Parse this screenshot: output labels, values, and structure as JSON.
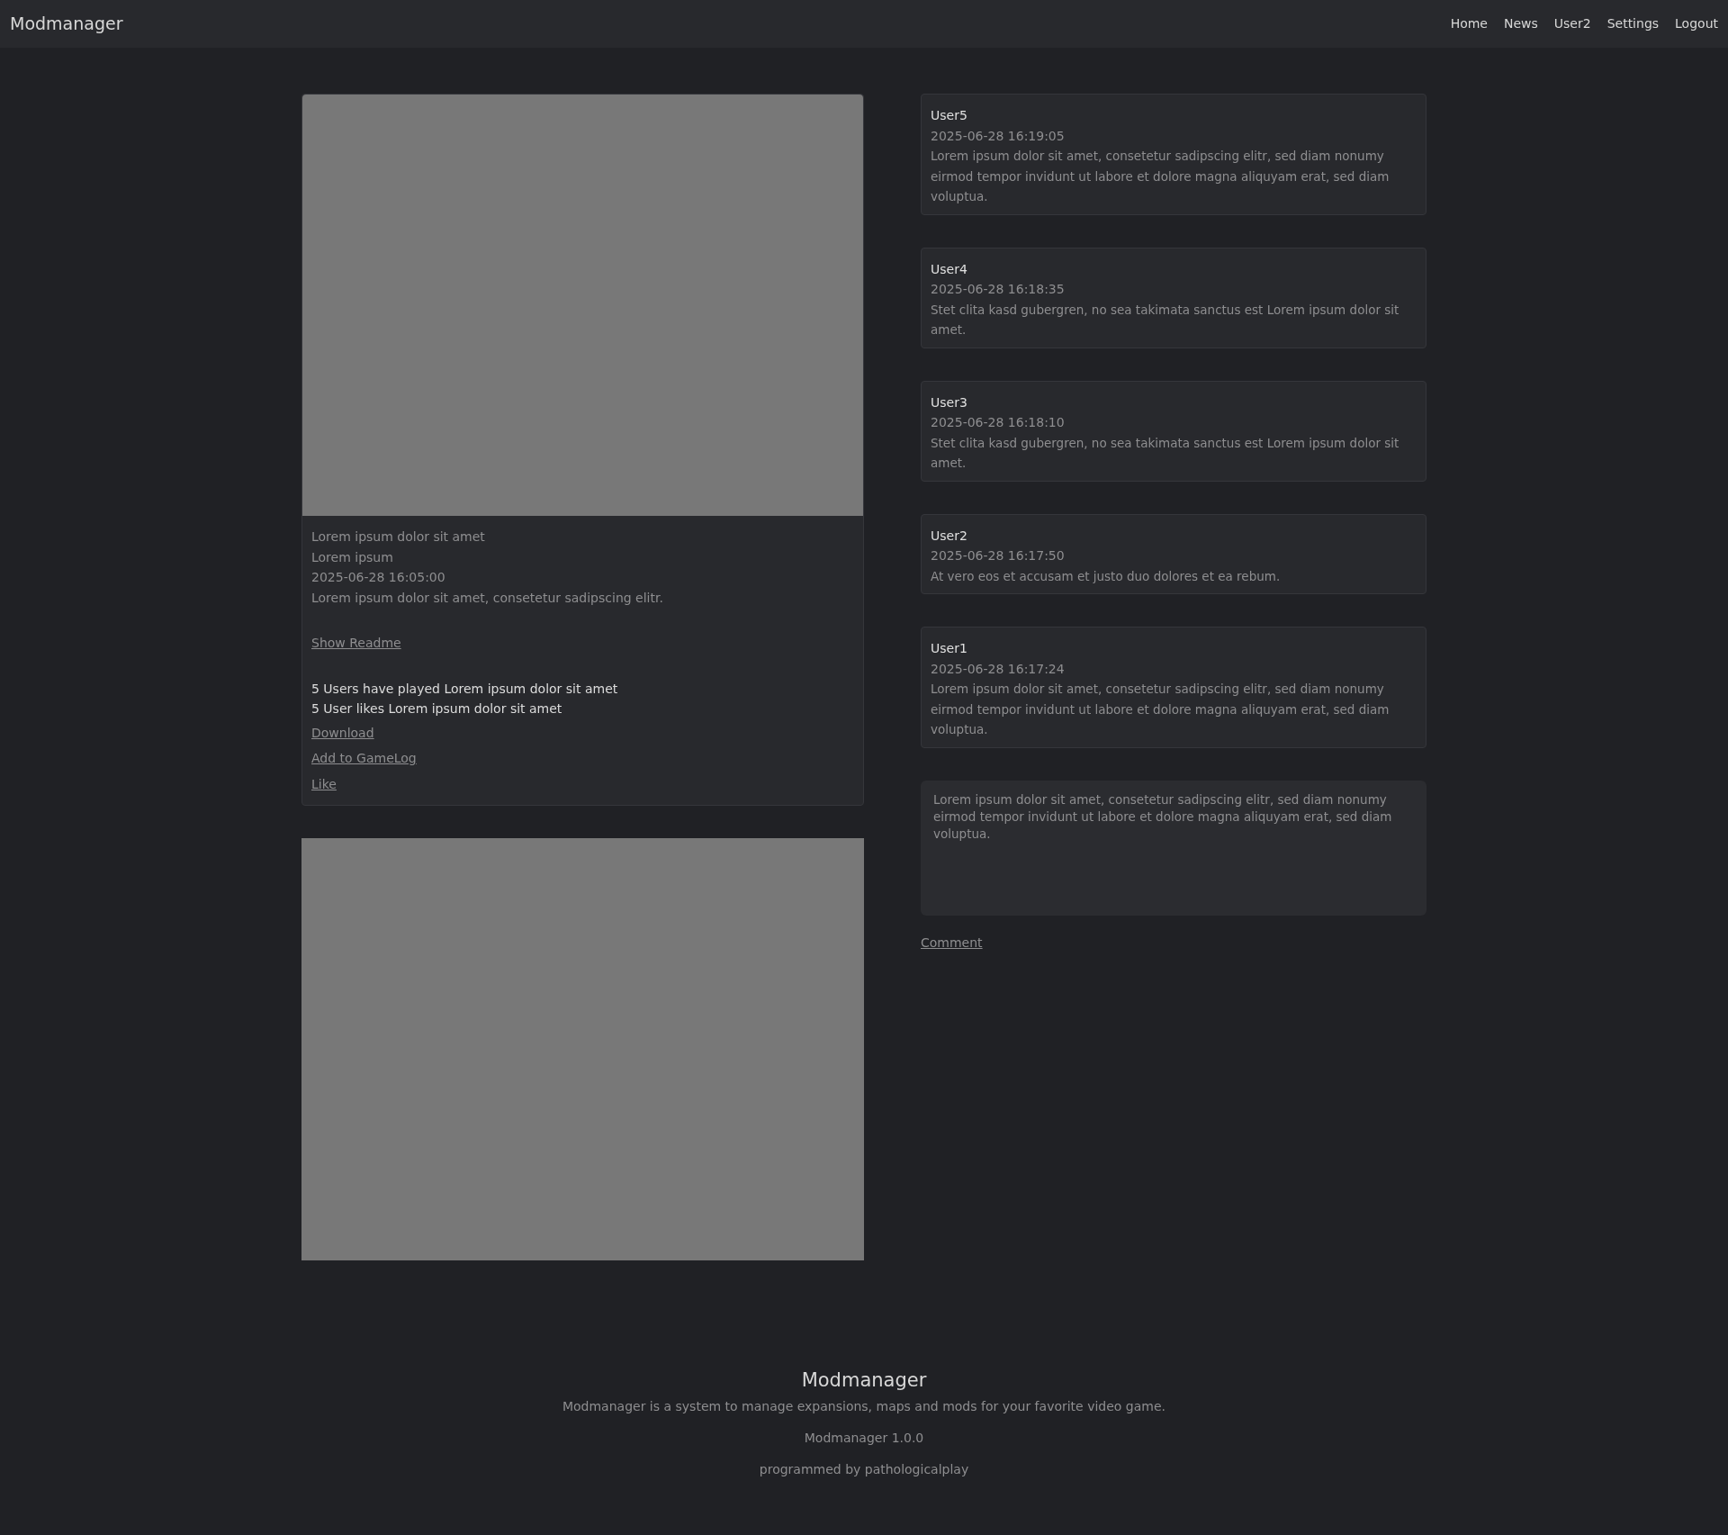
{
  "navbar": {
    "brand": "Modmanager",
    "links": [
      {
        "label": "Home"
      },
      {
        "label": "News"
      },
      {
        "label": "User2"
      },
      {
        "label": "Settings"
      },
      {
        "label": "Logout"
      }
    ]
  },
  "mod": {
    "title": "Lorem ipsum dolor sit amet",
    "author": "Lorem ipsum",
    "date": "2025-06-28 16:05:00",
    "description": "Lorem ipsum dolor sit amet, consetetur sadipscing elitr.",
    "readme_link": "Show Readme",
    "played": "5 Users have played Lorem ipsum dolor sit amet",
    "likes": "5 User likes Lorem ipsum dolor sit amet",
    "actions": [
      "Download",
      "Add to GameLog",
      "Like"
    ]
  },
  "comments": [
    {
      "user": "User5",
      "date": "2025-06-28 16:19:05",
      "text": "Lorem ipsum dolor sit amet, consetetur sadipscing elitr, sed diam nonumy eirmod tempor invidunt ut labore et dolore magna aliquyam erat, sed diam voluptua."
    },
    {
      "user": "User4",
      "date": "2025-06-28 16:18:35",
      "text": "Stet clita kasd gubergren, no sea takimata sanctus est Lorem ipsum dolor sit amet."
    },
    {
      "user": "User3",
      "date": "2025-06-28 16:18:10",
      "text": "Stet clita kasd gubergren, no sea takimata sanctus est Lorem ipsum dolor sit amet."
    },
    {
      "user": "User2",
      "date": "2025-06-28 16:17:50",
      "text": "At vero eos et accusam et justo duo dolores et ea rebum."
    },
    {
      "user": "User1",
      "date": "2025-06-28 16:17:24",
      "text": "Lorem ipsum dolor sit amet, consetetur sadipscing elitr, sed diam nonumy eirmod tempor invidunt ut labore et dolore magna aliquyam erat, sed diam voluptua."
    }
  ],
  "comment_form": {
    "placeholder": "Lorem ipsum dolor sit amet, consetetur sadipscing elitr, sed diam nonumy eirmod tempor invidunt ut labore et dolore magna aliquyam erat, sed diam voluptua.",
    "submit": "Comment"
  },
  "footer": {
    "title": "Modmanager",
    "tagline": "Modmanager is a system to manage expansions, maps and mods for your favorite video game.",
    "version": "Modmanager 1.0.0",
    "credit": "programmed by pathologicalplay"
  }
}
